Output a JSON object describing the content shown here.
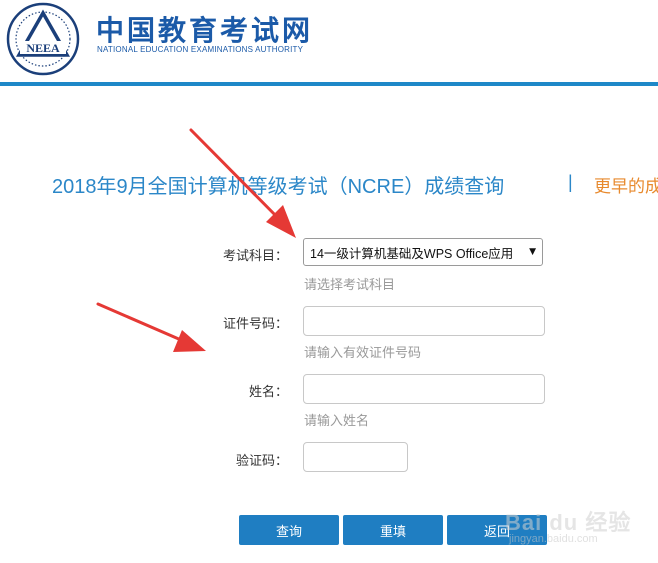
{
  "header": {
    "logo_text": "NEEA",
    "brand_cn": "中国教育考试网",
    "brand_en": "NATIONAL EDUCATION EXAMINATIONS AUTHORITY"
  },
  "page": {
    "title": "2018年9月全国计算机等级考试（NCRE）成绩查询",
    "separator": "|",
    "earlier_link": "更早的成"
  },
  "form": {
    "subject": {
      "label": "考试科目：",
      "selected": "14一级计算机基础及WPS Office应用",
      "hint": "请选择考试科目"
    },
    "id_number": {
      "label": "证件号码：",
      "value": "",
      "hint": "请输入有效证件号码"
    },
    "name": {
      "label": "姓名：",
      "value": "",
      "hint": "请输入姓名"
    },
    "captcha": {
      "label": "验证码：",
      "value": ""
    }
  },
  "buttons": {
    "query": "查询",
    "reset": "重填",
    "back": "返回"
  },
  "watermark": {
    "text": "Bai du 经验",
    "url": "jingyan.baidu.com"
  },
  "colors": {
    "brand_blue": "#1b5aa8",
    "header_line": "#1e88c8",
    "title_blue": "#2b87c8",
    "link_orange": "#e88a2e",
    "button_blue": "#1f7ec2",
    "arrow_red": "#e53935"
  },
  "icons": {
    "logo": "neea-emblem",
    "select_caret": "caret-down-icon",
    "annotation": "red-arrow"
  }
}
